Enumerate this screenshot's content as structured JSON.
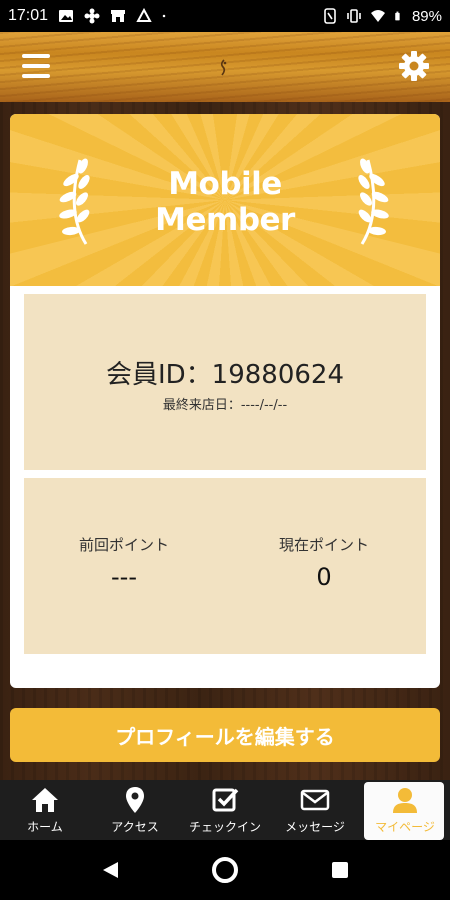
{
  "status_bar": {
    "time": "17:01",
    "battery": "89%"
  },
  "header": {
    "menu_icon": "hamburger-icon",
    "settings_icon": "gear-icon"
  },
  "banner": {
    "title_line1": "Mobile",
    "title_line2": "Member"
  },
  "member": {
    "id_label": "会員ID：19880624",
    "last_visit_label": "最終来店日：----/--/--"
  },
  "points": {
    "previous_label": "前回ポイント",
    "previous_value": "---",
    "current_label": "現在ポイント",
    "current_value": "0"
  },
  "edit_profile_button": "プロフィールを編集する",
  "tabs": [
    {
      "label": "ホーム",
      "icon": "home-icon"
    },
    {
      "label": "アクセス",
      "icon": "map-pin-icon"
    },
    {
      "label": "チェックイン",
      "icon": "checkbox-icon"
    },
    {
      "label": "メッセージ",
      "icon": "mail-icon"
    },
    {
      "label": "マイページ",
      "icon": "user-icon",
      "active": true
    }
  ],
  "colors": {
    "accent": "#f3bb38",
    "card_fill": "#f2e2c2",
    "tabbar": "#1e1e1e"
  }
}
